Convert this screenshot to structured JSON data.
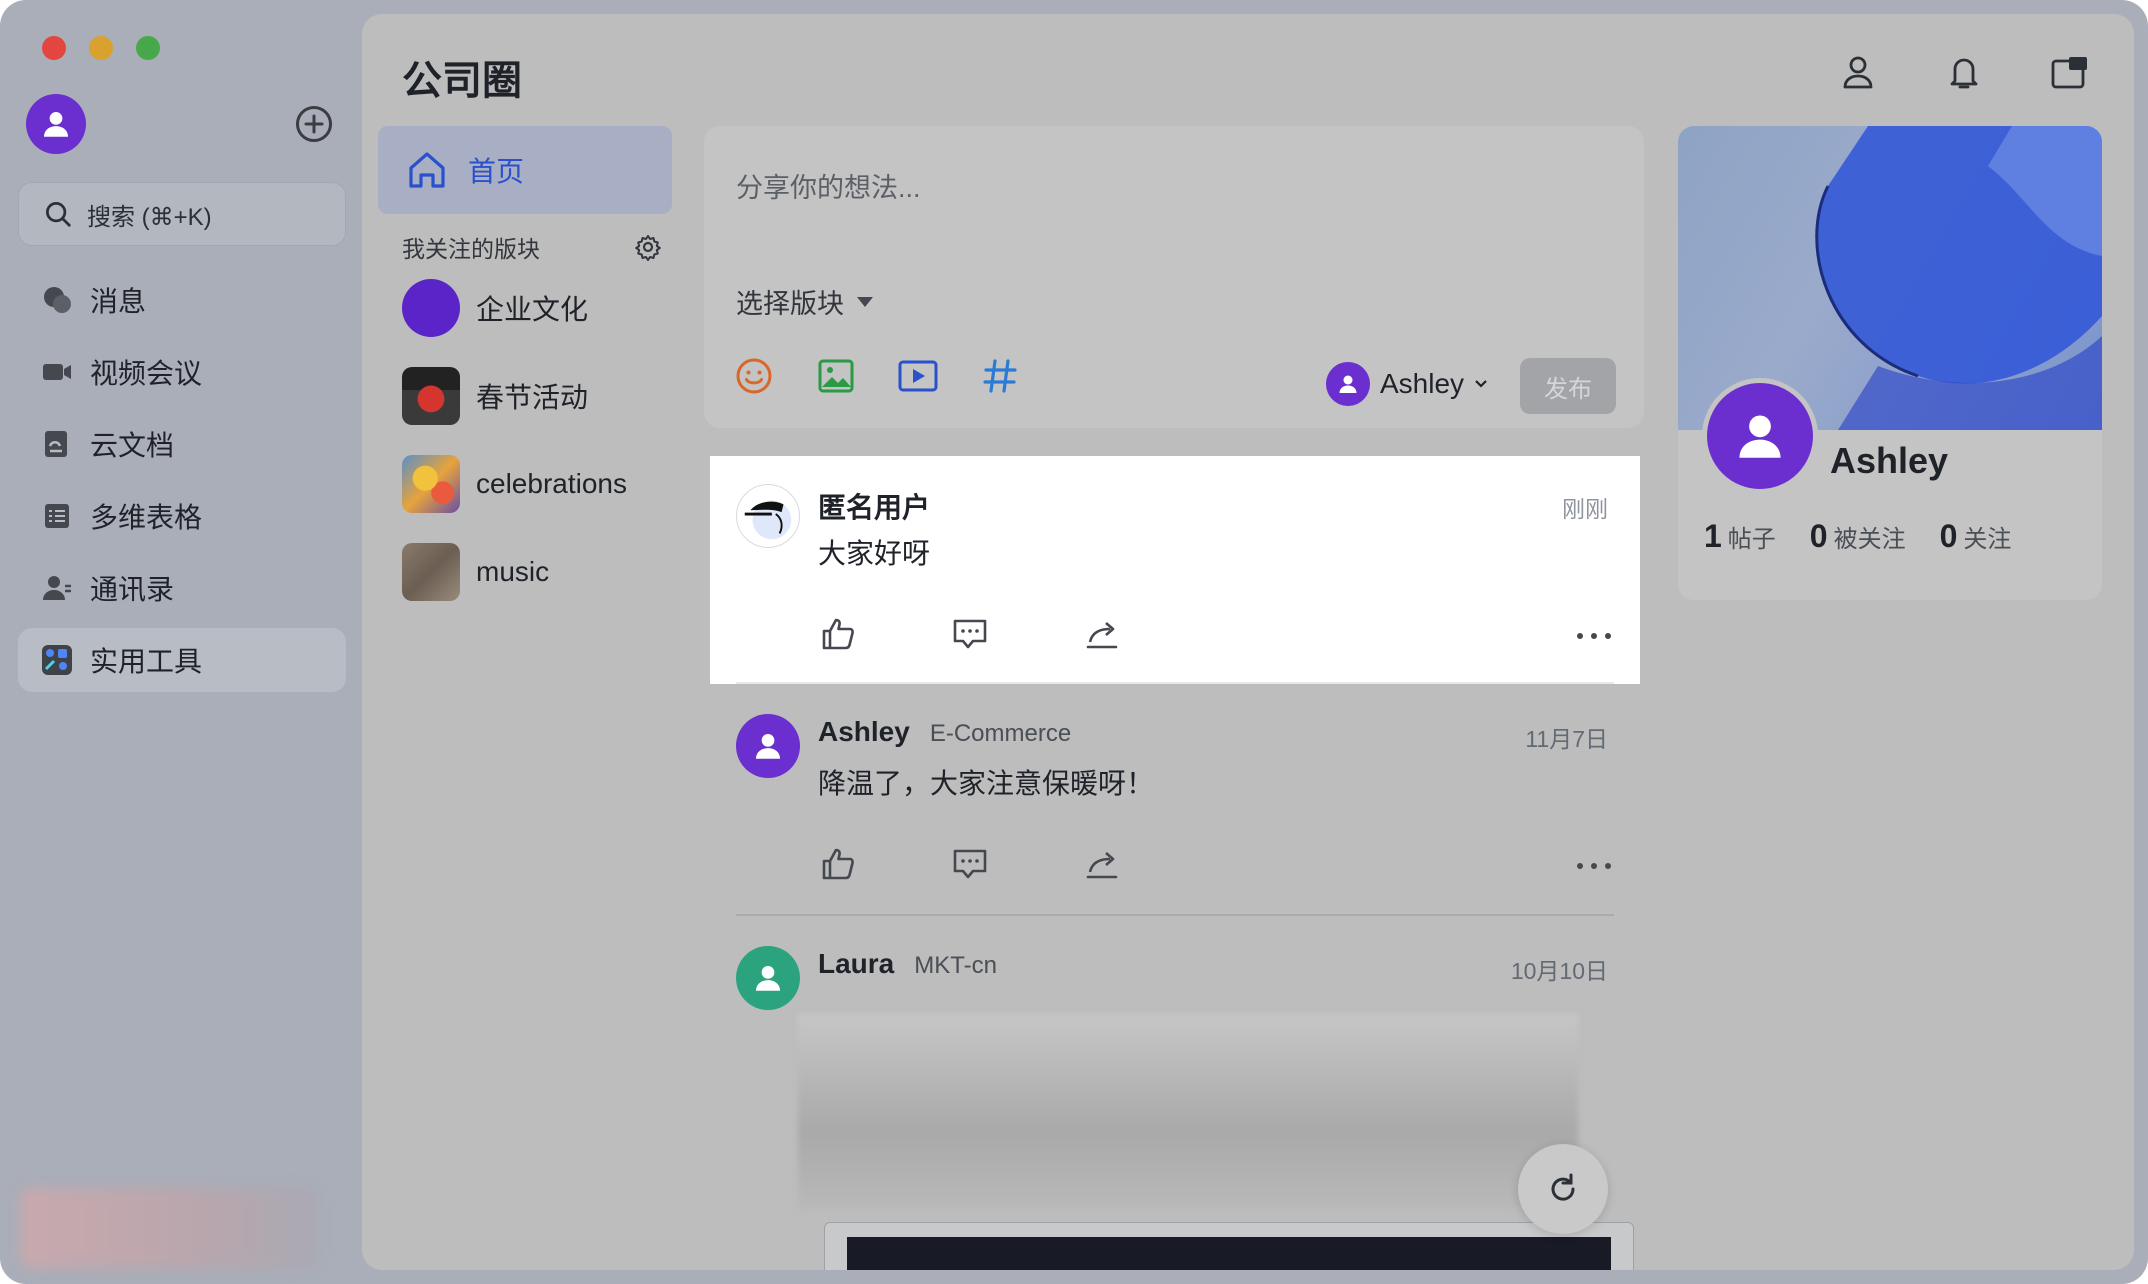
{
  "window": {
    "traffic_lights": [
      "close",
      "minimize",
      "maximize"
    ]
  },
  "sidebar": {
    "search_placeholder": "搜索 (⌘+K)",
    "items": [
      {
        "label": "消息",
        "icon": "chat-bubbles-icon"
      },
      {
        "label": "视频会议",
        "icon": "video-camera-icon"
      },
      {
        "label": "云文档",
        "icon": "cloud-doc-icon"
      },
      {
        "label": "多维表格",
        "icon": "table-icon"
      },
      {
        "label": "通讯录",
        "icon": "contacts-icon"
      },
      {
        "label": "实用工具",
        "icon": "tools-icon",
        "active": true
      }
    ]
  },
  "header": {
    "title": "公司圈",
    "icons": [
      "person-icon",
      "bell-icon",
      "new-window-icon"
    ]
  },
  "boards": {
    "home_label": "首页",
    "section_title": "我关注的版块",
    "items": [
      {
        "label": "企业文化"
      },
      {
        "label": "春节活动"
      },
      {
        "label": "celebrations"
      },
      {
        "label": "music"
      }
    ]
  },
  "composer": {
    "placeholder": "分享你的想法...",
    "select_board": "选择版块",
    "user_name": "Ashley",
    "publish_label": "发布",
    "tools": [
      "emoji-icon",
      "image-icon",
      "video-icon",
      "hashtag-icon"
    ]
  },
  "posts": [
    {
      "author": "匿名用户",
      "dept": "",
      "time": "刚刚",
      "text": "大家好呀"
    },
    {
      "author": "Ashley",
      "dept": "E-Commerce",
      "time": "11月7日",
      "text": "降温了，大家注意保暖呀！"
    },
    {
      "author": "Laura",
      "dept": "MKT-cn",
      "time": "10月10日",
      "text": ""
    }
  ],
  "profile": {
    "name": "Ashley",
    "stats": [
      {
        "num": "1",
        "label": "帖子"
      },
      {
        "num": "0",
        "label": "被关注"
      },
      {
        "num": "0",
        "label": "关注"
      }
    ]
  },
  "colors": {
    "accent": "#2a50cc",
    "avatar_purple": "#6b2fcf",
    "avatar_green": "#2ba37e"
  }
}
